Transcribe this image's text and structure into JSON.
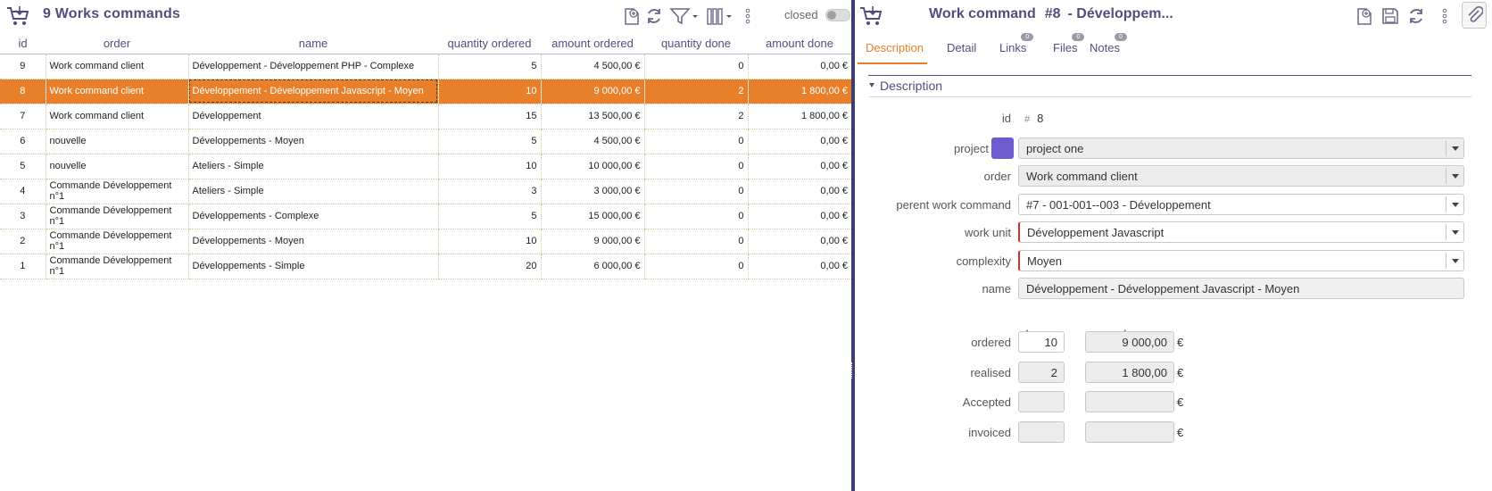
{
  "left": {
    "title": "9 Works commands",
    "closed_label": "closed",
    "icons": [
      "cart-icon",
      "new-item-icon",
      "refresh-icon",
      "filter-icon",
      "columns-icon",
      "more-icon"
    ],
    "columns": [
      "id",
      "order",
      "name",
      "quantity ordered",
      "amount ordered",
      "quantity done",
      "amount done"
    ],
    "rows": [
      {
        "id": "9",
        "order": "Work command client",
        "name": "Développement - Développement PHP - Complexe",
        "qty_ordered": "5",
        "amount_ordered": "4 500,00 €",
        "qty_done": "0",
        "amount_done": "0,00 €",
        "selected": false
      },
      {
        "id": "8",
        "order": "Work command client",
        "name": "Développement - Développement Javascript - Moyen",
        "qty_ordered": "10",
        "amount_ordered": "9 000,00 €",
        "qty_done": "2",
        "amount_done": "1 800,00 €",
        "selected": true
      },
      {
        "id": "7",
        "order": "Work command client",
        "name": "Développement",
        "qty_ordered": "15",
        "amount_ordered": "13 500,00 €",
        "qty_done": "2",
        "amount_done": "1 800,00 €",
        "selected": false
      },
      {
        "id": "6",
        "order": "nouvelle",
        "name": "Développements - Moyen",
        "qty_ordered": "5",
        "amount_ordered": "4 500,00 €",
        "qty_done": "0",
        "amount_done": "0,00 €",
        "selected": false
      },
      {
        "id": "5",
        "order": "nouvelle",
        "name": "Ateliers - Simple",
        "qty_ordered": "10",
        "amount_ordered": "10 000,00 €",
        "qty_done": "0",
        "amount_done": "0,00 €",
        "selected": false
      },
      {
        "id": "4",
        "order": "Commande Développement n°1",
        "name": "Ateliers - Simple",
        "qty_ordered": "3",
        "amount_ordered": "3 000,00 €",
        "qty_done": "0",
        "amount_done": "0,00 €",
        "selected": false
      },
      {
        "id": "3",
        "order": "Commande Développement n°1",
        "name": "Développements - Complexe",
        "qty_ordered": "5",
        "amount_ordered": "15 000,00 €",
        "qty_done": "0",
        "amount_done": "0,00 €",
        "selected": false
      },
      {
        "id": "2",
        "order": "Commande Développement n°1",
        "name": "Développements - Moyen",
        "qty_ordered": "10",
        "amount_ordered": "9 000,00 €",
        "qty_done": "0",
        "amount_done": "0,00 €",
        "selected": false
      },
      {
        "id": "1",
        "order": "Commande Développement n°1",
        "name": "Développements - Simple",
        "qty_ordered": "20",
        "amount_ordered": "6 000,00 €",
        "qty_done": "0",
        "amount_done": "0,00 €",
        "selected": false
      }
    ]
  },
  "right": {
    "title": "Work command",
    "number": "#8",
    "subtitle": "- Développem...",
    "icons": [
      "cart-icon",
      "new-item-icon",
      "save-icon",
      "refresh-icon",
      "more-icon",
      "attachment-icon"
    ],
    "tabs": [
      {
        "label": "Description",
        "badge": null
      },
      {
        "label": "Detail",
        "badge": null
      },
      {
        "label": "Links",
        "badge": "0"
      },
      {
        "label": "Files",
        "badge": "0"
      },
      {
        "label": "Notes",
        "badge": "0"
      }
    ],
    "section_title": "Description",
    "fields": {
      "id_label": "id",
      "id_hash": "#",
      "id_value": "8",
      "project_label": "project",
      "project_value": "project one",
      "project_color": "#6e5bd0",
      "order_label": "order",
      "order_value": "Work command client",
      "parent_label": "perent work command",
      "parent_value": "#7 - 001-001--003 - Développement",
      "work_unit_label": "work unit",
      "work_unit_value": "Développement Javascript",
      "complexity_label": "complexity",
      "complexity_value": "Moyen",
      "name_label": "name",
      "name_value": "Développement - Développement Javascript - Moyen"
    },
    "amounts": {
      "qty_header": "qty",
      "amount_header": "amount",
      "currency": "€",
      "rows": [
        {
          "label": "ordered",
          "qty": "10",
          "amount": "9 000,00"
        },
        {
          "label": "realised",
          "qty": "2",
          "amount": "1 800,00"
        },
        {
          "label": "Accepted",
          "qty": "",
          "amount": ""
        },
        {
          "label": "invoiced",
          "qty": "",
          "amount": ""
        }
      ]
    }
  },
  "colors": {
    "accent": "#e8802b",
    "brand": "#4f4f7d",
    "splitter": "#3e3e6e",
    "required": "#d03030"
  }
}
